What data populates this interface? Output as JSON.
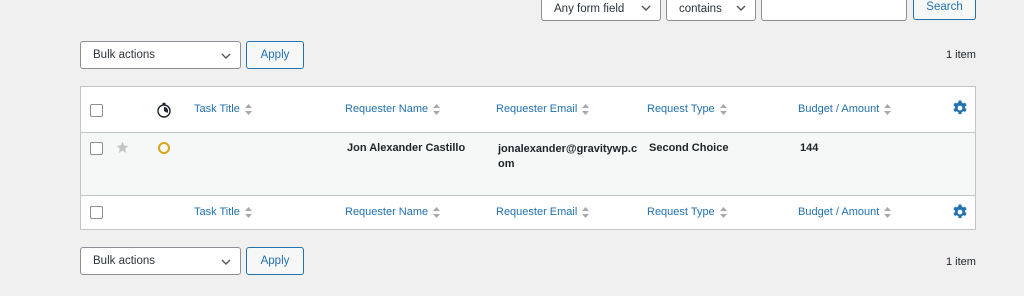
{
  "filter": {
    "field_select": "Any form field",
    "operator_select": "contains",
    "search_value": "",
    "search_button": "Search"
  },
  "top_actions": {
    "bulk_select": "Bulk actions",
    "apply_button": "Apply",
    "item_count": "1 item"
  },
  "table": {
    "columns": {
      "task_title": "Task Title",
      "requester_name": "Requester Name",
      "requester_email": "Requester Email",
      "request_type": "Request Type",
      "budget_amount": "Budget / Amount"
    },
    "rows": [
      {
        "task_title": "",
        "requester_name": "Jon Alexander Castillo",
        "requester_email_line1": "jonalexander@gravitywp.c",
        "requester_email_line2": "om",
        "request_type": "Second Choice",
        "budget_amount": "144",
        "starred": false,
        "read": false
      }
    ]
  },
  "bottom_actions": {
    "bulk_select": "Bulk actions",
    "apply_button": "Apply",
    "item_count": "1 item"
  },
  "colors": {
    "accent": "#2271b1",
    "unread_circle": "#dba617",
    "star_inactive": "#c3c4c7"
  },
  "icons": {
    "chevron": "chevron-down-icon",
    "sort": "sort-icon",
    "read_status": "stopwatch-icon",
    "gear": "gear-icon",
    "star": "star-icon",
    "unread": "circle-icon"
  }
}
